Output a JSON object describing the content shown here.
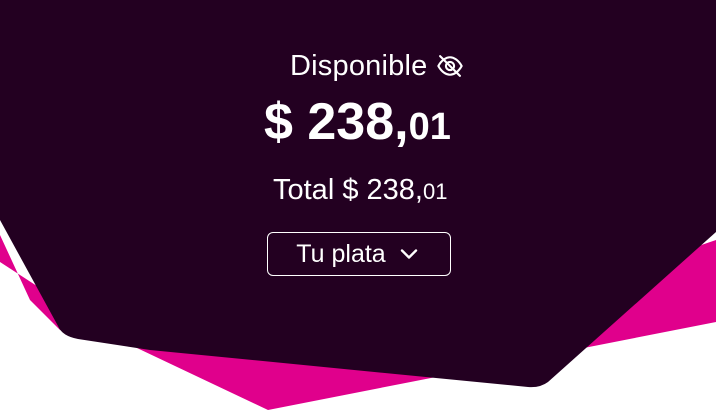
{
  "balance": {
    "available_label": "Disponible",
    "available_currency": "$",
    "available_integer": "238,",
    "available_cents": "01",
    "total_prefix": "Total $ 238,",
    "total_cents": "01",
    "account_selector_label": "Tu plata"
  },
  "icons": {
    "visibility_toggle": "eye-off-icon",
    "dropdown_indicator": "chevron-down-icon"
  },
  "colors": {
    "panel_background": "#230021",
    "accent_magenta": "#e0008c",
    "page_background": "#ffffff",
    "text": "#ffffff"
  }
}
